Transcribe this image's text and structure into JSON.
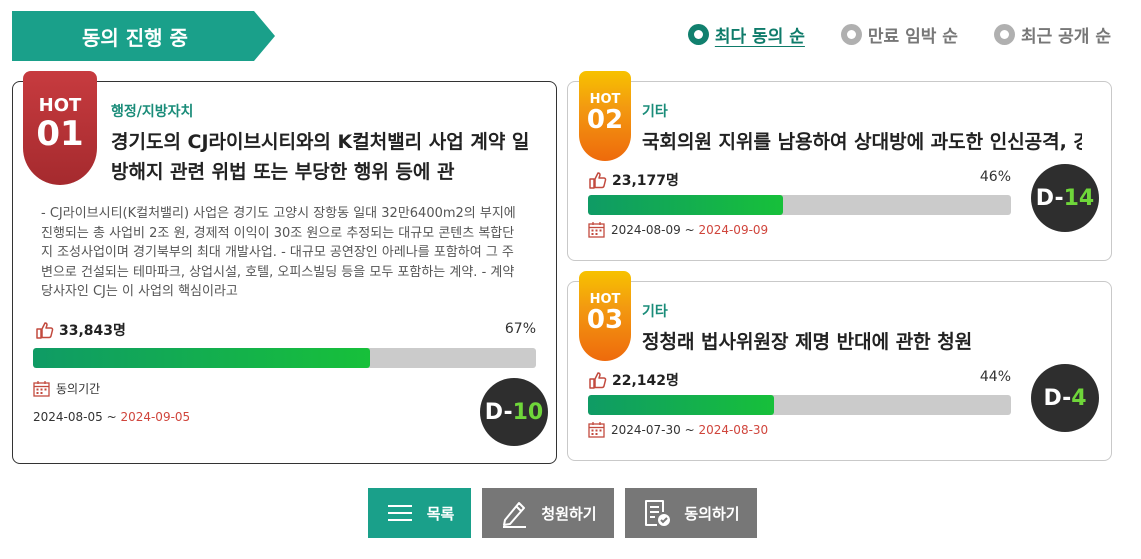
{
  "header": {
    "title": "동의 진행 중"
  },
  "sort": [
    {
      "label": "최다 동의 순",
      "active": true
    },
    {
      "label": "만료 임박 순",
      "active": false
    },
    {
      "label": "최근 공개 순",
      "active": false
    }
  ],
  "petitions": [
    {
      "hot_label": "HOT",
      "rank": "01",
      "category": "행정/지방자치",
      "title": "경기도의 CJ라이브시티와의 K컬처밸리 사업 계약 일방해지 관련 위법 또는 부당한 행위 등에 관",
      "summary": "- CJ라이브시티(K컬처밸리) 사업은 경기도 고양시 장항동 일대 32만6400m2의 부지에 진행되는 총 사업비 2조 원, 경제적 이익이 30조 원으로 추정되는 대규모 콘텐츠 복합단지 조성사업이며 경기북부의 최대 개발사업. - 대규모 공연장인 아레나를 포함하여 그 주변으로 건설되는 테마파크, 상업시설, 호텔, 오피스빌딩 등을 모두 포함하는 계약. - 계약 당사자인 CJ는 이 사업의 핵심이라고",
      "count": "33,843명",
      "percent_label": "67%",
      "percent": 67,
      "period_label": "동의기간",
      "start": "2024-08-05",
      "separator": " ~ ",
      "end": "2024-09-05",
      "dday_prefix": "D-",
      "dday_num": "10"
    },
    {
      "hot_label": "HOT",
      "rank": "02",
      "category": "기타",
      "title": "국회의원 지위를 남용하여 상대방에 과도한 인신공격, 강",
      "count": "23,177명",
      "percent_label": "46%",
      "percent": 46,
      "start": "2024-08-09",
      "separator": " ~ ",
      "end": "2024-09-09",
      "dday_prefix": "D-",
      "dday_num": "14"
    },
    {
      "hot_label": "HOT",
      "rank": "03",
      "category": "기타",
      "title": "정청래 법사위원장 제명 반대에 관한 청원",
      "count": "22,142명",
      "percent_label": "44%",
      "percent": 44,
      "start": "2024-07-30",
      "separator": " ~ ",
      "end": "2024-08-30",
      "dday_prefix": "D-",
      "dday_num": "4"
    }
  ],
  "buttons": {
    "list": "목록",
    "petition": "청원하기",
    "agree": "동의하기"
  },
  "colors": {
    "brand_green": "#1aa08a",
    "progress_green": "#17c03a",
    "end_date_red": "#d0453c",
    "dday_accent": "#6fd63a"
  },
  "icons": [
    "thumbs-up-icon",
    "calendar-icon",
    "list-icon",
    "pencil-icon",
    "document-check-icon"
  ]
}
